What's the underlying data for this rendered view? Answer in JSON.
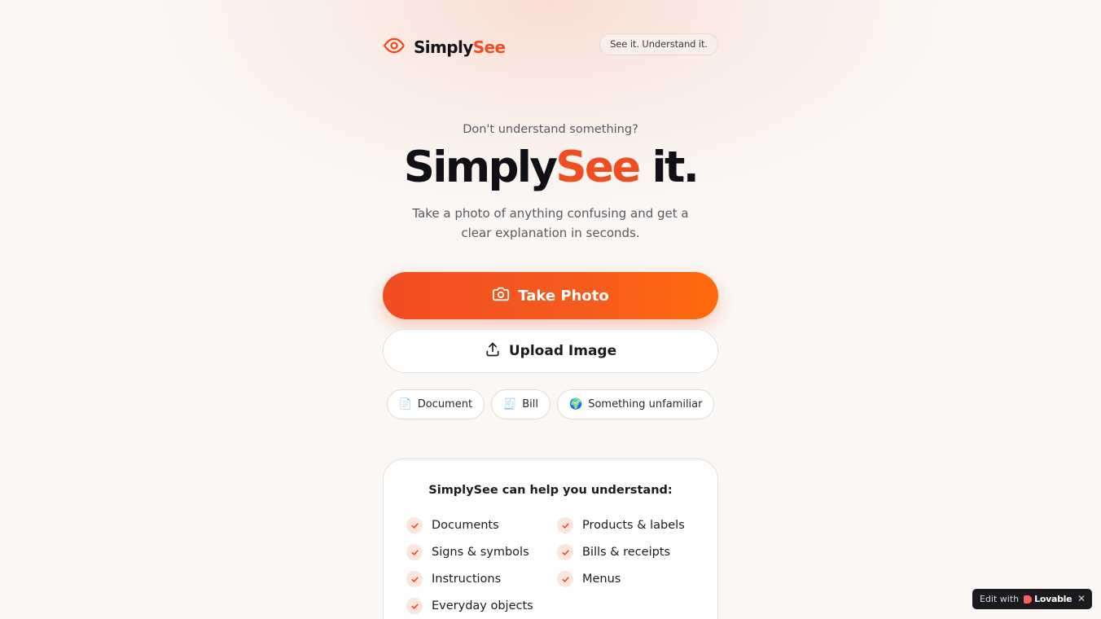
{
  "header": {
    "brand_main": "Simply",
    "brand_accent": "See",
    "tagline": "See it. Understand it."
  },
  "hero": {
    "pretitle": "Don't understand something?",
    "title_main": "Simply",
    "title_accent": "See",
    "title_end": " it.",
    "subtitle": "Take a photo of anything confusing and get a clear explanation in seconds."
  },
  "actions": {
    "take_photo": "Take Photo",
    "upload_image": "Upload Image"
  },
  "chips": [
    {
      "icon": "📄",
      "label": "Document"
    },
    {
      "icon": "🧾",
      "label": "Bill"
    },
    {
      "icon": "🌍",
      "label": "Something unfamiliar"
    }
  ],
  "help_card": {
    "title": "SimplySee can help you understand:",
    "items": [
      "Documents",
      "Products & labels",
      "Signs & symbols",
      "Bills & receipts",
      "Instructions",
      "Menus",
      "Everyday objects"
    ]
  },
  "badge": {
    "edit_label": "Edit with",
    "brand": "Lovable",
    "close": "✕"
  },
  "colors": {
    "accent": "#ee4e22",
    "background": "#faf7f4"
  }
}
